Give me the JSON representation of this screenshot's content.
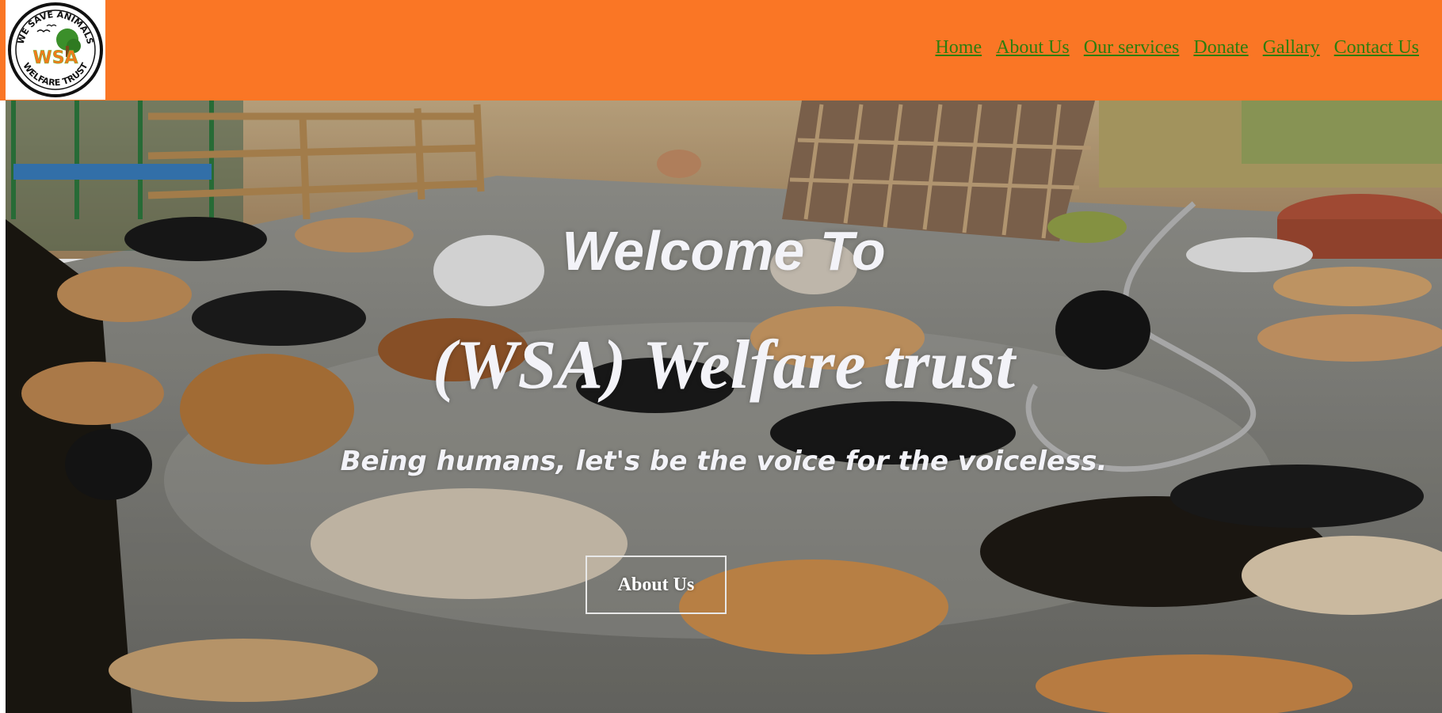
{
  "header": {
    "logo": {
      "top_text": "WE SAVE ANIMALS",
      "center_text": "WSA",
      "bottom_text": "WELFARE TRUST"
    },
    "nav": [
      {
        "label": "Home"
      },
      {
        "label": "About Us"
      },
      {
        "label": "Our services"
      },
      {
        "label": "Donate"
      },
      {
        "label": "Gallary"
      },
      {
        "label": "Contact Us"
      }
    ],
    "colors": {
      "bar": "#fa7625",
      "link": "#2e7d0e"
    }
  },
  "hero": {
    "heading_line1": "Welcome To",
    "heading_line2": "(WSA) Welfare trust",
    "tagline": "Being humans, let's be the voice for the voiceless.",
    "button_label": "About Us",
    "background": "photo of many dogs resting on a concrete floor at a shelter"
  }
}
